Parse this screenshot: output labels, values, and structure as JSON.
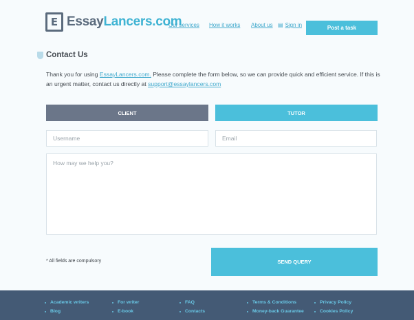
{
  "logo": {
    "mark": "E",
    "part1": "Essay",
    "part2": "Lancers.com"
  },
  "nav": {
    "services": "Our services",
    "how": "How it works",
    "about": "About us",
    "signin": "Sign in",
    "post_task": "Post a task"
  },
  "page": {
    "title": "Contact Us"
  },
  "intro": {
    "t1": "Thank you for using ",
    "link1": "EssayLancers.com.",
    "t2": " Please complete the form below, so we can provide quick and efficient service. If this is an urgent matter, contact us directly at ",
    "email": "support@essaylancers.com"
  },
  "tabs": {
    "client": "CLIENT",
    "tutor": "TUTOR"
  },
  "form": {
    "username_placeholder": "Username",
    "email_placeholder": "Email",
    "message_placeholder": "How may we help you?",
    "note": "* All fields are compulsory",
    "send": "SEND QUERY"
  },
  "footer": {
    "links": [
      [
        "Academic writers",
        "Blog"
      ],
      [
        "For writer",
        "E-book"
      ],
      [
        "FAQ",
        "Contacts"
      ],
      [
        "Terms & Conditions",
        "Money-back Guarantee"
      ],
      [
        "Privacy Policy",
        "Cookies Policy"
      ]
    ]
  },
  "colors": {
    "accent": "#4bbfdb",
    "slate": "#6b7689",
    "footer": "#445a75",
    "link": "#3fa8cc"
  },
  "icons": {
    "logo": "logo-e-icon",
    "section": "shield-icon",
    "signin": "signin-icon",
    "bullet": "bullet-icon"
  }
}
